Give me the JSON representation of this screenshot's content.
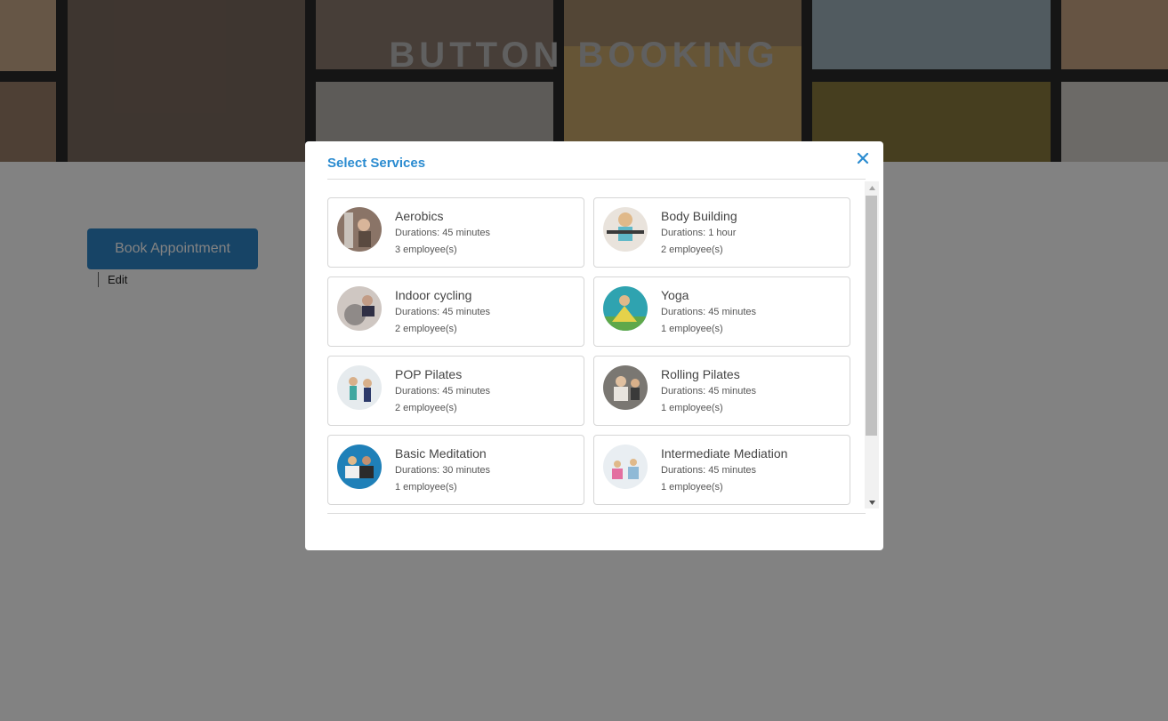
{
  "hero": {
    "title": "BUTTON BOOKING"
  },
  "page": {
    "book_label": "Book Appointment",
    "edit_label": "Edit"
  },
  "modal": {
    "title": "Select Services",
    "services": [
      {
        "name": "Aerobics",
        "duration": "Durations: 45 minutes",
        "employees": "3 employee(s)"
      },
      {
        "name": "Body Building",
        "duration": "Durations: 1 hour",
        "employees": "2 employee(s)"
      },
      {
        "name": "Indoor cycling",
        "duration": "Durations: 45 minutes",
        "employees": "2 employee(s)"
      },
      {
        "name": "Yoga",
        "duration": "Durations: 45 minutes",
        "employees": "1 employee(s)"
      },
      {
        "name": "POP Pilates",
        "duration": "Durations: 45 minutes",
        "employees": "2 employee(s)"
      },
      {
        "name": "Rolling Pilates",
        "duration": "Durations: 45 minutes",
        "employees": "1 employee(s)"
      },
      {
        "name": "Basic Meditation",
        "duration": "Durations: 30 minutes",
        "employees": "1 employee(s)"
      },
      {
        "name": "Intermediate Mediation",
        "duration": "Durations: 45 minutes",
        "employees": "1 employee(s)"
      }
    ]
  },
  "colors": {
    "accent": "#2a8bd0",
    "button": "#2e86c9"
  }
}
